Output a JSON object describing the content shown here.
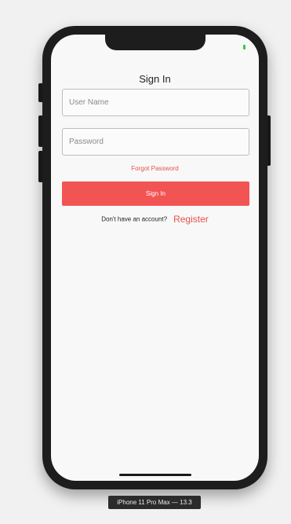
{
  "screen": {
    "title": "Sign In",
    "username": {
      "placeholder": "User Name",
      "value": ""
    },
    "password": {
      "placeholder": "Password",
      "value": ""
    },
    "forgot_label": "Forgot Password",
    "signin_label": "Sign In",
    "no_account_text": "Don't have an account?",
    "register_label": "Register"
  },
  "simulator": {
    "device_label": "iPhone 11 Pro Max — 13.3"
  },
  "colors": {
    "accent": "#f25454",
    "link": "#e5534b",
    "battery": "#2ecc40"
  }
}
